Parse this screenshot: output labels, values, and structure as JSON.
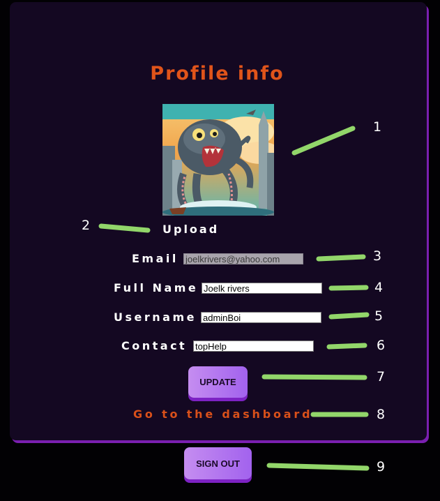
{
  "profile": {
    "title": "Profile info",
    "upload_label": "Upload"
  },
  "fields": {
    "email": {
      "label": "Email",
      "value": "joelkrivers@yahoo.com"
    },
    "full_name": {
      "label": "Full Name",
      "value": "Joelk rivers"
    },
    "username": {
      "label": "Username",
      "value": "adminBoi"
    },
    "contact": {
      "label": "Contact",
      "value": "topHelp"
    }
  },
  "buttons": {
    "update": "UPDATE",
    "sign_out": "SIGN OUT"
  },
  "links": {
    "dashboard": "Go to the dashboard"
  },
  "annotations": [
    "1",
    "2",
    "3",
    "4",
    "5",
    "6",
    "7",
    "8",
    "9"
  ],
  "colors": {
    "page_background": "#020104",
    "card_background": "#140822",
    "card_shadow": "#7a1fb0",
    "accent_orange": "#e0541a",
    "button_gradient_start": "#c58df0",
    "button_gradient_end": "#a262ee",
    "annotation_marker": "#92d66a"
  },
  "icons": {
    "avatar": "octopus-monster-illustration"
  }
}
